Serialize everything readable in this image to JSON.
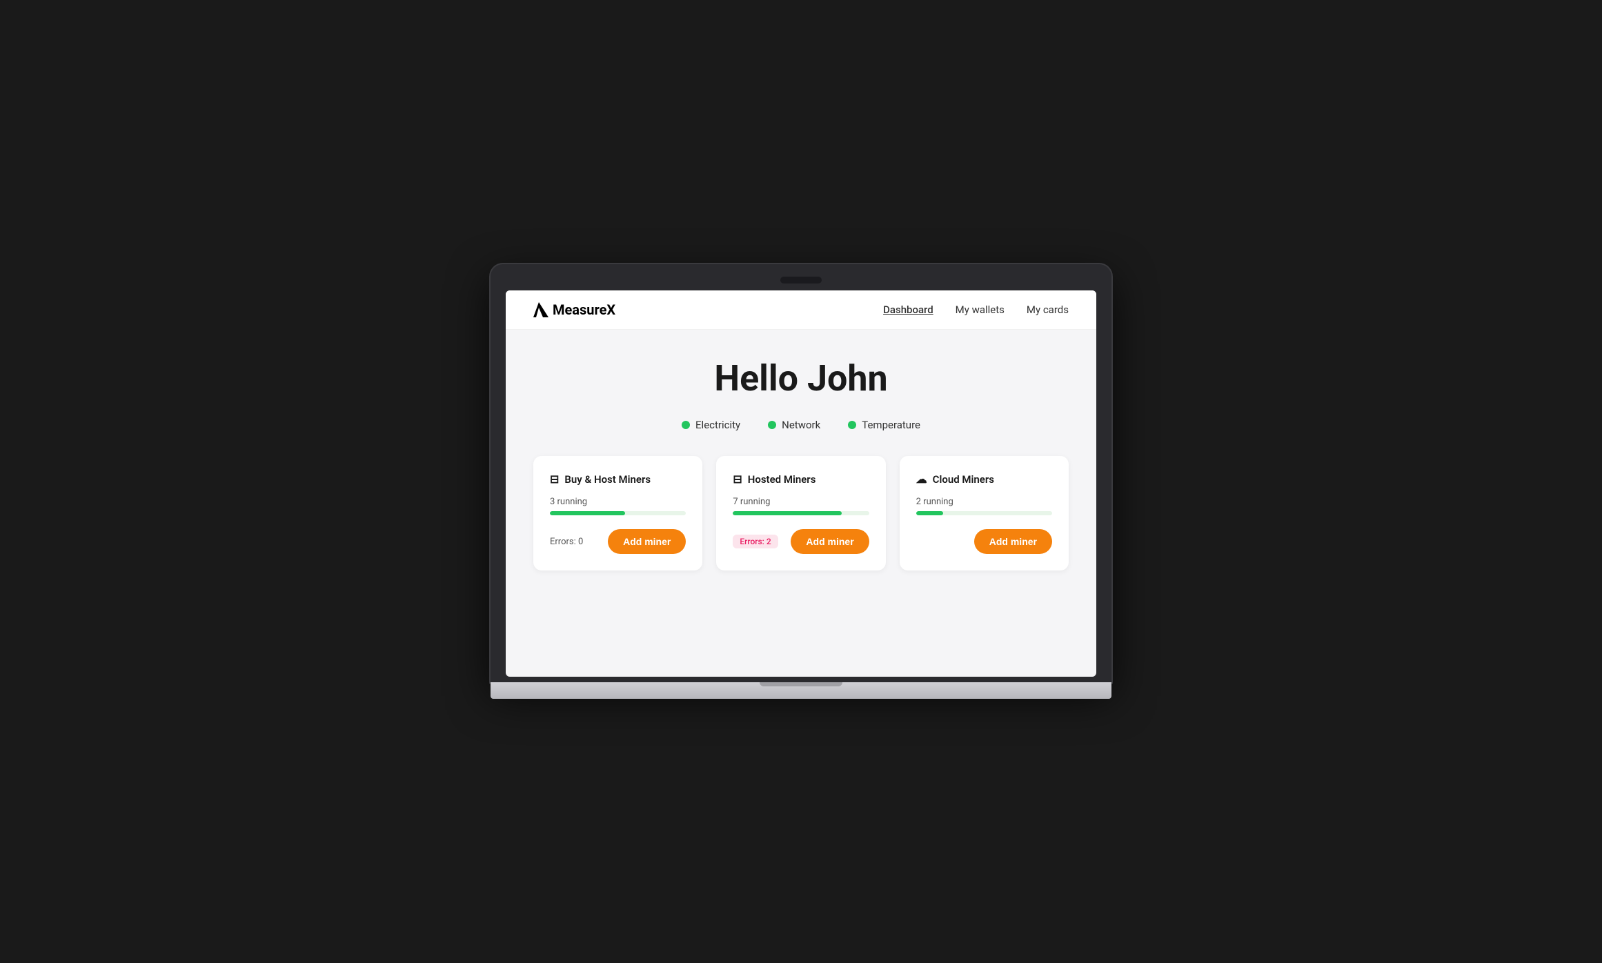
{
  "app": {
    "title": "MeasureX"
  },
  "nav": {
    "logo_text": "MeasureX",
    "links": [
      {
        "label": "Dashboard",
        "active": true
      },
      {
        "label": "My wallets",
        "active": false
      },
      {
        "label": "My cards",
        "active": false
      }
    ]
  },
  "greeting": "Hello John",
  "status_indicators": [
    {
      "label": "Electricity",
      "color": "#22c55e"
    },
    {
      "label": "Network",
      "color": "#22c55e"
    },
    {
      "label": "Temperature",
      "color": "#22c55e"
    }
  ],
  "cards": [
    {
      "id": "buy-host",
      "icon": "🖥",
      "title": "Buy & Host Miners",
      "running_count": "3 running",
      "progress_pct": 55,
      "errors_label": "Errors: 0",
      "errors_badge": null,
      "add_label": "Add miner"
    },
    {
      "id": "hosted",
      "icon": "🖥",
      "title": "Hosted Miners",
      "running_count": "7 running",
      "progress_pct": 80,
      "errors_label": null,
      "errors_badge": "Errors: 2",
      "add_label": "Add miner"
    },
    {
      "id": "cloud",
      "icon": "☁",
      "title": "Cloud Miners",
      "running_count": "2 running",
      "progress_pct": 20,
      "errors_label": null,
      "errors_badge": null,
      "add_label": "Add miner"
    }
  ]
}
